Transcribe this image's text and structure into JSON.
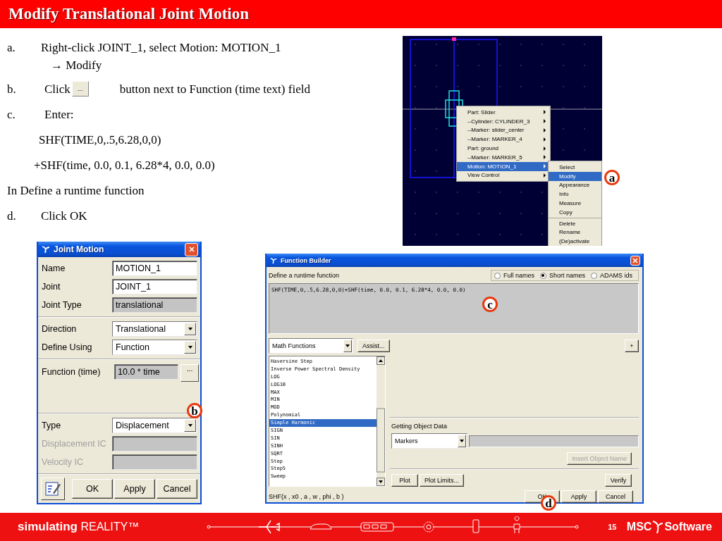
{
  "slide": {
    "title": "Modify Translational Joint Motion"
  },
  "steps": [
    {
      "kind": "step",
      "marker": "a.",
      "text": "Right-click JOINT_1, select Motion: MOTION_1",
      "continuation": "→ Modify"
    },
    {
      "kind": "button_step",
      "marker": "b.",
      "before": "Click",
      "button": "...",
      "after": "button next to Function (time text) field"
    },
    {
      "kind": "step",
      "marker": "c.",
      "text": "Enter:"
    },
    {
      "kind": "code",
      "text": "SHF(TIME,0,.5,6.28,0,0)"
    },
    {
      "kind": "code",
      "text": "+SHF(time, 0.0, 0.1, 6.28*4, 0.0, 0.0)"
    },
    {
      "kind": "plain",
      "text": "In Define a runtime function"
    },
    {
      "kind": "step",
      "marker": "d.",
      "text": "Click OK"
    }
  ],
  "viewport": {
    "context_menu": [
      {
        "label": "Part: Slider",
        "has_submenu": true,
        "selected": false
      },
      {
        "label": "--Cylinder: CYLINDER_3",
        "has_submenu": true,
        "selected": false
      },
      {
        "label": "--Marker: slider_center",
        "has_submenu": true,
        "selected": false
      },
      {
        "label": "--Marker: MARKER_4",
        "has_submenu": true,
        "selected": false
      },
      {
        "label": "Part: ground",
        "has_submenu": true,
        "selected": false
      },
      {
        "label": "--Marker: MARKER_5",
        "has_submenu": true,
        "selected": false
      },
      {
        "label": "Motion: MOTION_1",
        "has_submenu": true,
        "selected": true
      },
      {
        "label": "View Control",
        "has_submenu": true,
        "selected": false
      }
    ],
    "submenu": [
      {
        "label": "Select",
        "selected": false,
        "separator_before": false
      },
      {
        "label": "Modify",
        "selected": true,
        "separator_before": false
      },
      {
        "label": "Appearance",
        "selected": false,
        "separator_before": false
      },
      {
        "label": "Info",
        "selected": false,
        "separator_before": false
      },
      {
        "label": "Measure",
        "selected": false,
        "separator_before": false
      },
      {
        "label": "Copy",
        "selected": false,
        "separator_before": false
      },
      {
        "label": "Delete",
        "selected": false,
        "separator_before": true
      },
      {
        "label": "Rename",
        "selected": false,
        "separator_before": false
      },
      {
        "label": "(De)activate",
        "selected": false,
        "separator_before": false
      }
    ],
    "callout": "a"
  },
  "joint_motion": {
    "title": "Joint Motion",
    "sections": [
      [
        {
          "kind": "text",
          "label": "Name",
          "value": "MOTION_1",
          "disabled": false
        },
        {
          "kind": "text",
          "label": "Joint",
          "value": "JOINT_1",
          "disabled": false
        },
        {
          "kind": "readonly",
          "label": "Joint Type",
          "value": "translational",
          "disabled": false
        }
      ],
      [
        {
          "kind": "dropdown",
          "label": "Direction",
          "value": "Translational",
          "disabled": false
        },
        {
          "kind": "dropdown",
          "label": "Define Using",
          "value": "Function",
          "disabled": false
        }
      ],
      [
        {
          "kind": "function",
          "label": "Function (time)",
          "value": "10.0 * time",
          "button": "...",
          "disabled": false
        }
      ],
      [
        {
          "kind": "dropdown",
          "label": "Type",
          "value": "Displacement",
          "disabled": false
        },
        {
          "kind": "readonly",
          "label": "Displacement IC",
          "disabled": true
        },
        {
          "kind": "readonly",
          "label": "Velocity IC",
          "disabled": true
        }
      ]
    ],
    "buttons": [
      "OK",
      "Apply",
      "Cancel"
    ],
    "callout": "b"
  },
  "function_builder": {
    "title": "Function Builder",
    "label": "Define a runtime function",
    "name_options": [
      {
        "label": "Full names",
        "selected": false
      },
      {
        "label": "Short names",
        "selected": true
      },
      {
        "label": "ADAMS ids",
        "selected": false
      }
    ],
    "expression": "SHF(TIME,0,.5,6.28,0,0)+SHF(time, 0.0, 0.1, 6.28*4, 0.0, 0.0)",
    "category": "Math Functions",
    "assist_button": "Assist...",
    "add_button": "+",
    "functions": [
      {
        "label": "Haversine Step",
        "selected": false
      },
      {
        "label": "Inverse Power Spectral Density",
        "selected": false
      },
      {
        "label": "LOG",
        "selected": false
      },
      {
        "label": "LOG10",
        "selected": false
      },
      {
        "label": "MAX",
        "selected": false
      },
      {
        "label": "MIN",
        "selected": false
      },
      {
        "label": "MOD",
        "selected": false
      },
      {
        "label": "Polynomial",
        "selected": false
      },
      {
        "label": "Simple Harmonic",
        "selected": true
      },
      {
        "label": "SIGN",
        "selected": false
      },
      {
        "label": "SIN",
        "selected": false
      },
      {
        "label": "SINH",
        "selected": false
      },
      {
        "label": "SQRT",
        "selected": false
      },
      {
        "label": "Step",
        "selected": false
      },
      {
        "label": "Step5",
        "selected": false
      },
      {
        "label": "Sweep",
        "selected": false
      }
    ],
    "object_data_label": "Getting Object Data",
    "object_type": "Markers",
    "insert_button": "Insert Object Name",
    "plot_buttons": [
      "Plot",
      "Plot Limits..."
    ],
    "verify_button": "Verify",
    "signature": "SHF(x , x0 , a , w , phi , b )",
    "buttons": [
      "OK",
      "Apply",
      "Cancel"
    ],
    "callout_expression": "c",
    "callout_ok": "d"
  },
  "footer": {
    "tagline": "**simulating** REALITY™",
    "page": "15",
    "logo": [
      "MSC",
      "Software"
    ]
  }
}
